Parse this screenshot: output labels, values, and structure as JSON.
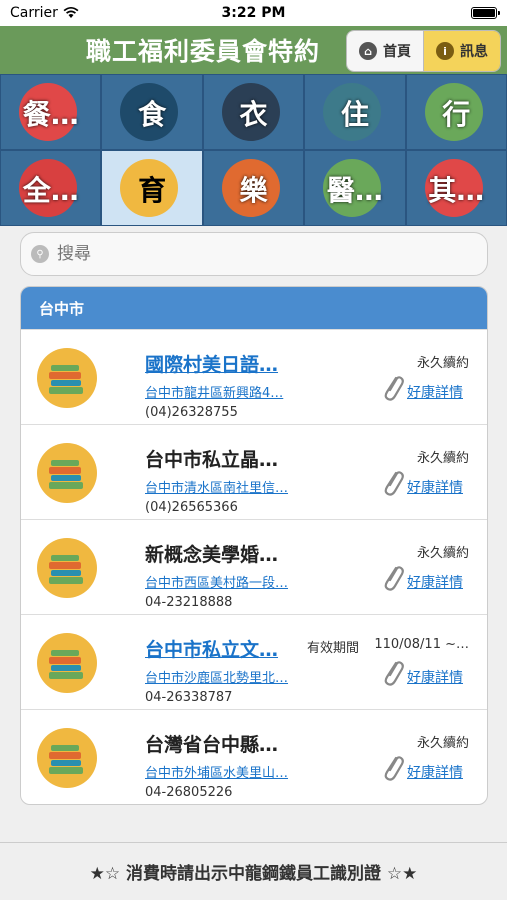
{
  "status_bar": {
    "carrier": "Carrier",
    "time": "3:22 PM"
  },
  "header": {
    "title": "職工福利委員會特約",
    "home_label": "首頁",
    "info_label": "訊息"
  },
  "categories": [
    {
      "label": "餐…",
      "icon": "utensils-icon",
      "color": "#e04848"
    },
    {
      "label": "食",
      "icon": "bowl-icon",
      "color": "#1e4a6a"
    },
    {
      "label": "衣",
      "icon": "suit-icon",
      "color": "#2b3f55"
    },
    {
      "label": "住",
      "icon": "house-icon",
      "color": "#3d7a8a"
    },
    {
      "label": "行",
      "icon": "car-icon",
      "color": "#6aa85a"
    },
    {
      "label": "全…",
      "icon": "sale-icon",
      "color": "#d84040"
    },
    {
      "label": "育",
      "icon": "books-icon",
      "color": "#f0b840"
    },
    {
      "label": "樂",
      "icon": "gamepad-icon",
      "color": "#e06a30"
    },
    {
      "label": "醫…",
      "icon": "medical-icon",
      "color": "#6aa85a"
    },
    {
      "label": "其…",
      "icon": "star-icon",
      "color": "#e04848"
    }
  ],
  "search": {
    "placeholder": "搜尋"
  },
  "section": {
    "title": "台中市"
  },
  "items": [
    {
      "name": "國際村美日語…",
      "address": "台中市龍井區新興路4…",
      "phone": "(04)26328755",
      "status_label": "",
      "status": "永久續約",
      "detail": "好康詳情"
    },
    {
      "name": "台中市私立晶…",
      "address": "台中市清水區南社里信…",
      "phone": "(04)26565366",
      "status_label": "",
      "status": "永久續約",
      "detail": "好康詳情"
    },
    {
      "name": "新概念美學婚…",
      "address": "台中市西區美村路一段…",
      "phone": "04-23218888",
      "status_label": "",
      "status": "永久續約",
      "detail": "好康詳情"
    },
    {
      "name": "台中市私立文…",
      "address": "台中市沙鹿區北勢里北…",
      "phone": "04-26338787",
      "status_label": "有效期間",
      "status": "110/08/11 ~…",
      "detail": "好康詳情"
    },
    {
      "name": "台灣省台中縣…",
      "address": "台中市外埔區水美里山…",
      "phone": "04-26805226",
      "status_label": "",
      "status": "永久續約",
      "detail": "好康詳情"
    }
  ],
  "footer": {
    "text": "★☆ 消費時請出示中龍鋼鐵員工識別證 ☆★"
  }
}
